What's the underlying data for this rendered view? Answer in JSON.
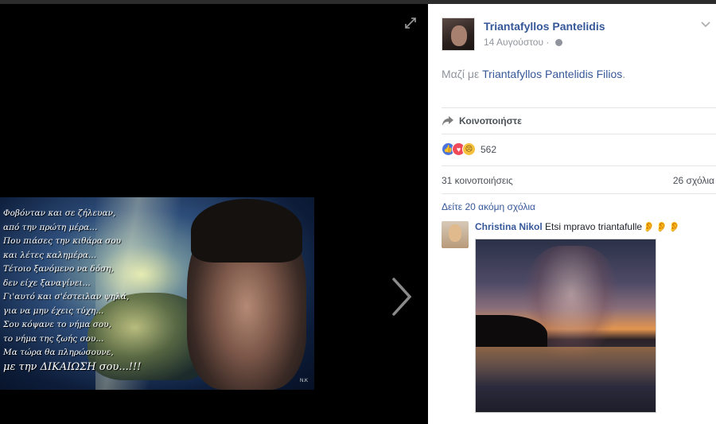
{
  "viewer": {
    "verse_lines": [
      "Φοβόνταν και σε ζήλευαν,",
      "από την πρώτη μέρα...",
      "Που πιάσες την κιθάρα σου",
      "και λέτες καλημέρα...",
      "Τέτοιο ξανόμενο να δόση,",
      "δεν είχε ξαναγίνει...",
      "Γι'αυτό και σ'έστειλαν ψηλά,",
      "για να μην έχεις τύχη...",
      "Σου κόψανε το νήμα σου,",
      "το νήμα της ζωής σου...",
      "Μα τώρα θα πληρώσουνε,",
      "με την ΔΙΚΑΙΩΣΗ σου...!!!"
    ],
    "signature": "N.K"
  },
  "post": {
    "author": "Triantafyllos Pantelidis",
    "date": "14 Αυγούστου",
    "date_sep": "·",
    "caption_prefix": "Μαζί με",
    "caption_link": "Triantafyllos Pantelidis Filios",
    "caption_suffix": ".",
    "share_label": "Κοινοποιήστε",
    "reaction_count": "562",
    "shares": "31 κοινοποιήσεις",
    "comments": "26 σχόλια",
    "more_comments": "Δείτε 20 ακόμη σχόλια"
  },
  "comment": {
    "name": "Christina Nikol",
    "text": "Etsi mpravo triantafulle",
    "emoji": [
      "👂",
      "👂",
      "👂"
    ]
  },
  "colors": {
    "link": "#365899",
    "muted": "#90949c",
    "like": "#4a75dd",
    "love": "#f04a5a",
    "sad": "#f5c03c"
  }
}
